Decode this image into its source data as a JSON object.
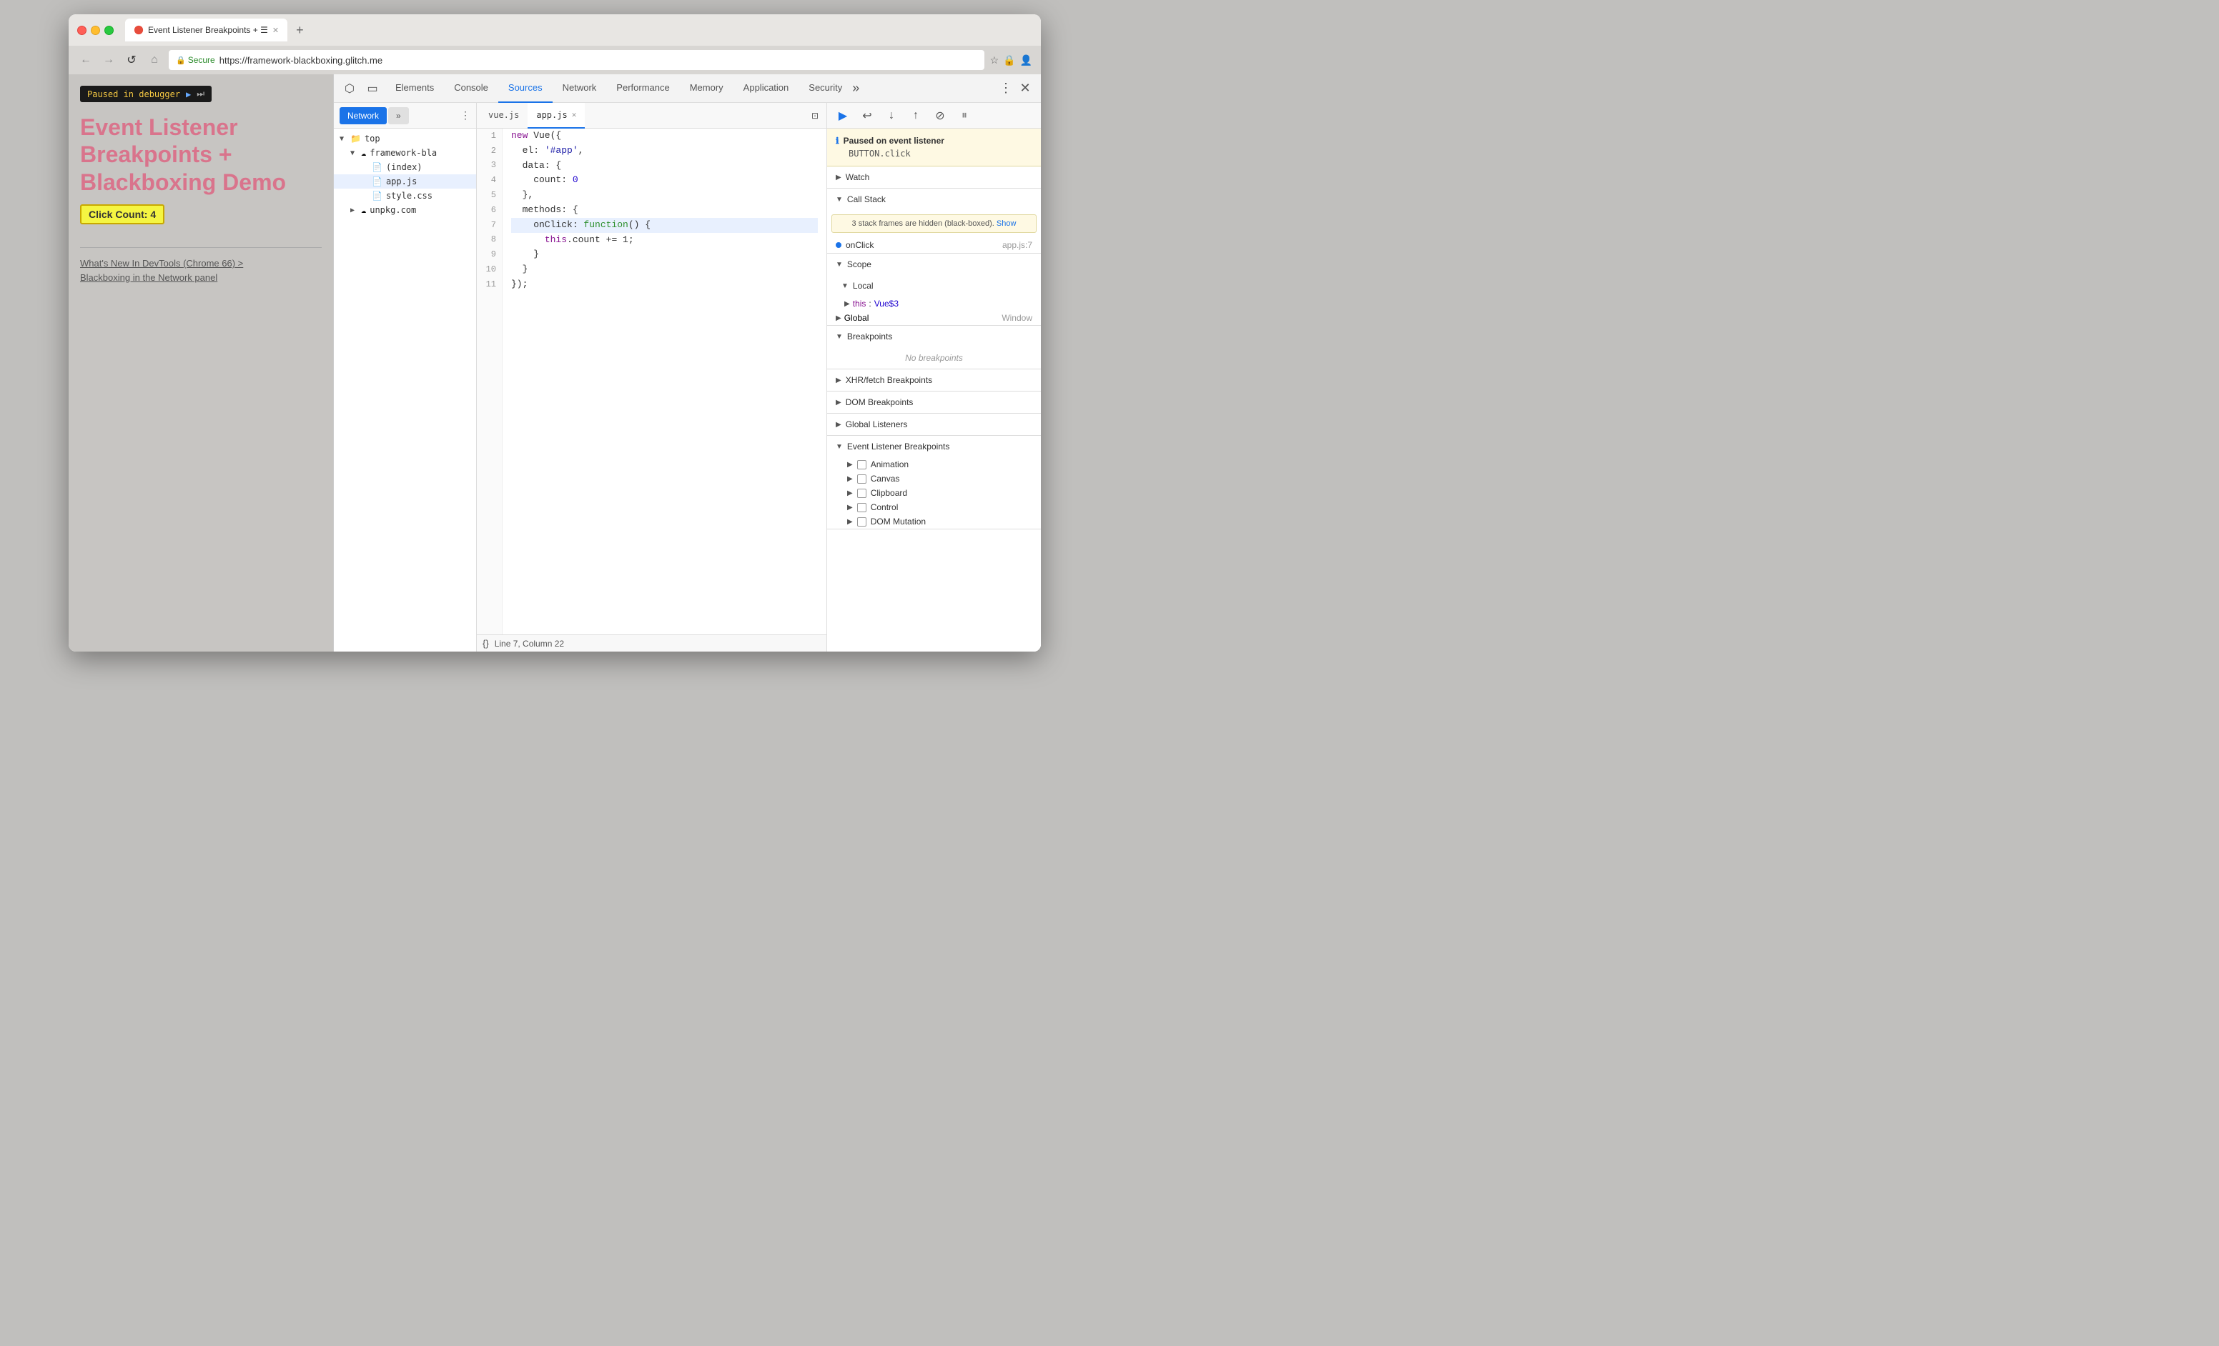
{
  "browser": {
    "titlebar": {
      "tab_title": "Event Listener Breakpoints + ☰",
      "tab_favicon": "🔴",
      "new_tab_label": "+"
    },
    "urlbar": {
      "secure_label": "Secure",
      "url": "https://framework-blackboxing.glitch.me",
      "back_label": "←",
      "forward_label": "→",
      "reload_label": "↺",
      "home_label": "⌂"
    }
  },
  "page": {
    "debugger_banner": "Paused in debugger",
    "title_line1": "Event Listener",
    "title_line2": "Breakpoints +",
    "title_line3": "Blackboxing Demo",
    "click_count": "Click Count: 4",
    "link1": "What's New In DevTools (Chrome 66) >",
    "link2": "Blackboxing in the Network panel"
  },
  "devtools": {
    "tabs": {
      "elements": "Elements",
      "console": "Console",
      "sources": "Sources",
      "network": "Network",
      "performance": "Performance",
      "memory": "Memory",
      "application": "Application",
      "security": "Security",
      "more": "»"
    },
    "sources": {
      "sidebar_tabs": [
        "Network",
        "»"
      ],
      "file_tree": {
        "top": "top",
        "framework_bla": "framework-bla",
        "index": "(index)",
        "app_js": "app.js",
        "style_css": "style.css",
        "unpkg": "unpkg.com"
      },
      "code_tabs": {
        "vue_js": "vue.js",
        "app_js": "app.js"
      },
      "code_lines": [
        {
          "num": 1,
          "text": "new Vue({",
          "tokens": [
            {
              "t": "kw",
              "v": "new"
            },
            {
              "t": "plain",
              "v": " Vue({"
            }
          ]
        },
        {
          "num": 2,
          "text": "  el: '#app',",
          "tokens": [
            {
              "t": "plain",
              "v": "  el: "
            },
            {
              "t": "str",
              "v": "'#app'"
            },
            {
              "t": "plain",
              "v": ","
            }
          ]
        },
        {
          "num": 3,
          "text": "  data: {",
          "tokens": [
            {
              "t": "plain",
              "v": "  data: {"
            }
          ]
        },
        {
          "num": 4,
          "text": "    count: 0",
          "tokens": [
            {
              "t": "plain",
              "v": "    count: "
            },
            {
              "t": "num",
              "v": "0"
            }
          ]
        },
        {
          "num": 5,
          "text": "  },",
          "tokens": [
            {
              "t": "plain",
              "v": "  },"
            }
          ]
        },
        {
          "num": 6,
          "text": "  methods: {",
          "tokens": [
            {
              "t": "plain",
              "v": "  methods: {"
            }
          ]
        },
        {
          "num": 7,
          "text": "    onClick: function() {",
          "tokens": [
            {
              "t": "plain",
              "v": "    onClick: "
            },
            {
              "t": "kw",
              "v": "function"
            },
            {
              "t": "plain",
              "v": "() {"
            }
          ],
          "highlight": true
        },
        {
          "num": 8,
          "text": "      this.count += 1;",
          "tokens": [
            {
              "t": "plain",
              "v": "      "
            },
            {
              "t": "kw",
              "v": "this"
            },
            {
              "t": "plain",
              "v": ".count += 1;"
            }
          ]
        },
        {
          "num": 9,
          "text": "    }",
          "tokens": [
            {
              "t": "plain",
              "v": "    }"
            }
          ]
        },
        {
          "num": 10,
          "text": "  }",
          "tokens": [
            {
              "t": "plain",
              "v": "  }"
            }
          ]
        },
        {
          "num": 11,
          "text": "});",
          "tokens": [
            {
              "t": "plain",
              "v": "});"
            }
          ]
        }
      ],
      "status_bar": "Line 7, Column 22"
    },
    "right_panel": {
      "debug_buttons": {
        "resume": "▶",
        "step_over": "↩",
        "step_into": "↓",
        "step_out": "↑",
        "deactivate": "⊘",
        "pause_exceptions": "⏸"
      },
      "paused": {
        "title": "Paused on event listener",
        "code": "BUTTON.click"
      },
      "watch": {
        "label": "Watch",
        "collapsed": true
      },
      "call_stack": {
        "label": "Call Stack",
        "warning": "3 stack frames are hidden (black-boxed).",
        "show_link": "Show",
        "items": [
          {
            "name": "onClick",
            "loc": "app.js:7"
          }
        ]
      },
      "scope": {
        "label": "Scope",
        "local": {
          "label": "Local",
          "items": [
            {
              "key": "this",
              "value": "Vue$3"
            }
          ]
        },
        "global": {
          "label": "Global",
          "value": "Window"
        }
      },
      "breakpoints": {
        "label": "Breakpoints",
        "empty": "No breakpoints"
      },
      "xhr_breakpoints": {
        "label": "XHR/fetch Breakpoints"
      },
      "dom_breakpoints": {
        "label": "DOM Breakpoints"
      },
      "global_listeners": {
        "label": "Global Listeners"
      },
      "event_listener_breakpoints": {
        "label": "Event Listener Breakpoints",
        "items": [
          {
            "label": "Animation"
          },
          {
            "label": "Canvas"
          },
          {
            "label": "Clipboard"
          },
          {
            "label": "Control"
          },
          {
            "label": "DOM Mutation"
          }
        ]
      }
    }
  }
}
